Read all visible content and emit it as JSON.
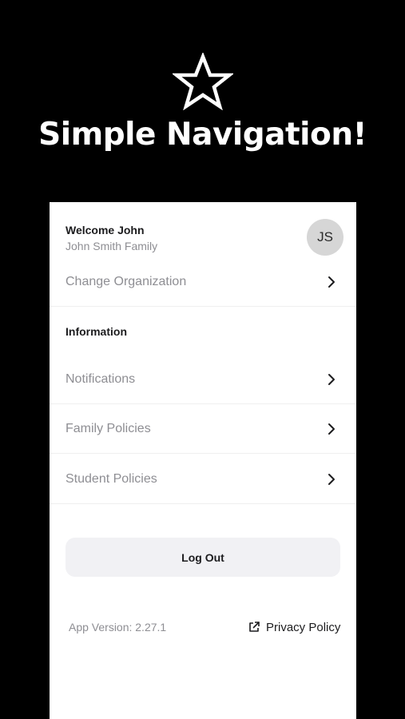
{
  "hero": {
    "title": "Simple Navigation!",
    "icon": "star-icon"
  },
  "profile": {
    "welcome": "Welcome John",
    "family": "John Smith Family",
    "initials": "JS"
  },
  "organization": {
    "label": "Change Organization"
  },
  "information": {
    "header": "Information",
    "items": [
      {
        "label": "Notifications"
      },
      {
        "label": "Family Policies"
      },
      {
        "label": "Student Policies"
      }
    ]
  },
  "actions": {
    "logout_label": "Log Out"
  },
  "footer": {
    "version": "App Version: 2.27.1",
    "privacy_label": "Privacy Policy",
    "privacy_icon": "external-link-icon"
  },
  "colors": {
    "background": "#000000",
    "panel": "#ffffff",
    "muted_text": "#8e8e93",
    "primary_text": "#1c1c1e",
    "avatar": "#d6d6d6",
    "button": "#f1f1f4"
  }
}
